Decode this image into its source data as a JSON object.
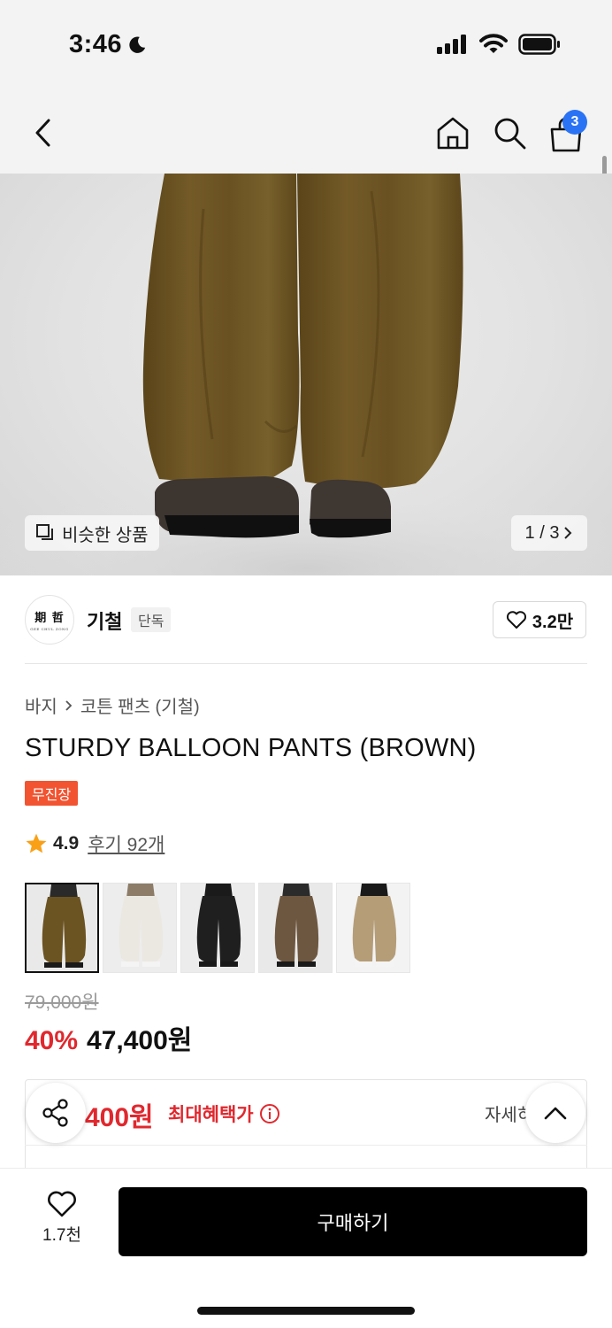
{
  "status_bar": {
    "time": "3:46"
  },
  "nav": {
    "cart_count": "3"
  },
  "hero": {
    "similar_label": "비슷한 상품",
    "pager": "1 / 3"
  },
  "brand": {
    "logo_text": "期 哲",
    "logo_subtext": "GEE CHUL ZONG",
    "name": "기철",
    "exclusive_label": "단독",
    "likes": "3.2만"
  },
  "product": {
    "breadcrumb": [
      "바지",
      "코튼 팬츠 (기철)"
    ],
    "title": "STURDY BALLOON PANTS (BROWN)",
    "free_shipping_label": "무진장",
    "rating": "4.9",
    "reviews_label": "후기 92개",
    "colors": [
      {
        "name": "brown",
        "pants": "#6b5322",
        "bg": "#e9e9e9",
        "top": "#2a2a2a"
      },
      {
        "name": "ivory",
        "pants": "#ebe8e2",
        "bg": "#ededed",
        "top": "#8c7c68"
      },
      {
        "name": "black",
        "pants": "#1f1f1f",
        "bg": "#ececec",
        "top": "#1a1a1a"
      },
      {
        "name": "dark-brown",
        "pants": "#6e5740",
        "bg": "#e9e9e9",
        "top": "#2b2b2b"
      },
      {
        "name": "beige",
        "pants": "#b59d78",
        "bg": "#f3f3f3",
        "top": "#1a1a1a"
      }
    ],
    "original_price": "79,000원",
    "discount_pct": "40%",
    "sale_price": "47,400원"
  },
  "benefit": {
    "amount": "400원",
    "label": "최대혜택가",
    "detail_label": "자세히"
  },
  "bottom_bar": {
    "wish_count": "1.7천",
    "buy_label": "구매하기"
  }
}
